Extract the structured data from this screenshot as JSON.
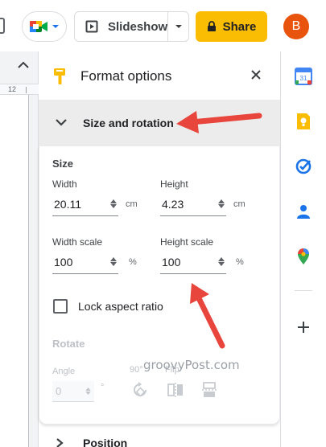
{
  "topbar": {
    "slideshow_label": "Slideshow",
    "share_label": "Share",
    "avatar_letter": "B",
    "colors": {
      "share": "#fbbc04",
      "avatar": "#e8530e"
    }
  },
  "ruler": {
    "mark": "12"
  },
  "panel": {
    "title": "Format options",
    "section_title": "Size and rotation",
    "size_heading": "Size",
    "width_label": "Width",
    "width_value": "20.11",
    "width_unit": "cm",
    "height_label": "Height",
    "height_value": "4.23",
    "height_unit": "cm",
    "width_scale_label": "Width scale",
    "width_scale_value": "100",
    "width_scale_unit": "%",
    "height_scale_label": "Height scale",
    "height_scale_value": "100",
    "height_scale_unit": "%",
    "lock_label": "Lock aspect ratio",
    "rotate_heading": "Rotate",
    "angle_label": "Angle",
    "angle_value": "0",
    "angle_unit": "°",
    "rotate90_label": "90°",
    "flip_label": "Flip",
    "next_section_title": "Position"
  },
  "watermark": "groovyPost.com",
  "sidebar_icons": [
    "calendar-icon",
    "keep-icon",
    "tasks-icon",
    "contacts-icon",
    "maps-icon",
    "add-icon"
  ],
  "sidebar": {
    "calendar_day": "31"
  },
  "annotation_color": "#e8453c"
}
